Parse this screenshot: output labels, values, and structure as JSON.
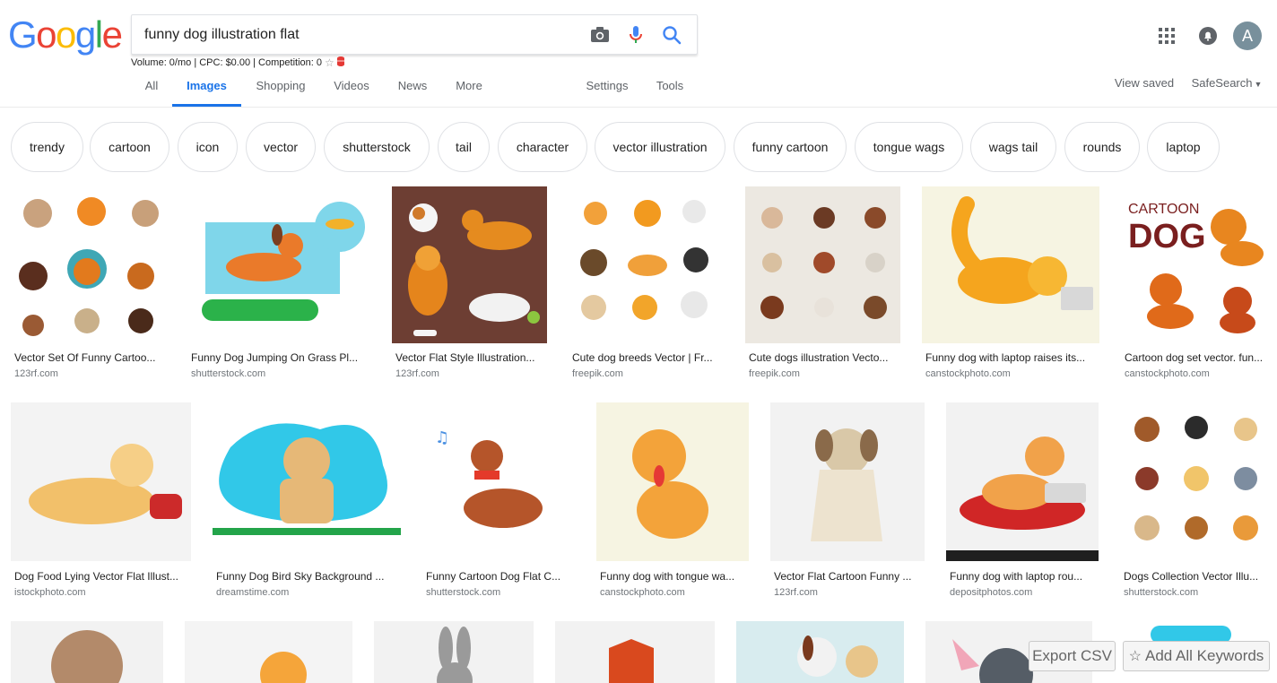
{
  "header": {
    "logo_letters": [
      "G",
      "o",
      "o",
      "g",
      "l",
      "e"
    ],
    "logo_colors": [
      "#4285F4",
      "#EA4335",
      "#FBBC05",
      "#4285F4",
      "#34A853",
      "#EA4335"
    ],
    "search_value": "funny dog illustration flat",
    "icons": {
      "camera": "camera-icon",
      "mic": "mic-icon",
      "search": "search-icon"
    },
    "meta_line": "Volume: 0/mo | CPC: $0.00 | Competition: 0",
    "avatar_letter": "A"
  },
  "tabs": {
    "all": "All",
    "images": "Images",
    "shopping": "Shopping",
    "videos": "Videos",
    "news": "News",
    "more": "More",
    "settings": "Settings",
    "tools": "Tools",
    "view_saved": "View saved",
    "safesearch": "SafeSearch"
  },
  "chips": [
    "trendy",
    "cartoon",
    "icon",
    "vector",
    "shutterstock",
    "tail",
    "character",
    "vector illustration",
    "funny cartoon",
    "tongue wags",
    "wags tail",
    "rounds",
    "laptop"
  ],
  "results": [
    {
      "title": "Vector Set Of Funny Cartoo...",
      "source": "123rf.com",
      "bg": "#ffffff"
    },
    {
      "title": "Funny Dog Jumping On Grass Pl...",
      "source": "shutterstock.com",
      "bg": "#ffffff"
    },
    {
      "title": "Vector Flat Style Illustration...",
      "source": "123rf.com",
      "bg": "#6d3e33"
    },
    {
      "title": "Cute dog breeds Vector | Fr...",
      "source": "freepik.com",
      "bg": "#ffffff"
    },
    {
      "title": "Cute dogs illustration Vecto...",
      "source": "freepik.com",
      "bg": "#ece8e1"
    },
    {
      "title": "Funny dog with laptop raises its...",
      "source": "canstockphoto.com",
      "bg": "#f6f4e2"
    },
    {
      "title": "Cartoon dog set vector. fun...",
      "source": "canstockphoto.com",
      "bg": "#ffffff"
    },
    {
      "title": "Dog Food Lying Vector Flat Illust...",
      "source": "istockphoto.com",
      "bg": "#f3f3f3"
    },
    {
      "title": "Funny Dog Bird Sky Background ...",
      "source": "dreamstime.com",
      "bg": "#ffffff"
    },
    {
      "title": "Funny Cartoon Dog Flat C...",
      "source": "shutterstock.com",
      "bg": "#ffffff"
    },
    {
      "title": "Funny dog with tongue wa...",
      "source": "canstockphoto.com",
      "bg": "#f6f4e2"
    },
    {
      "title": "Vector Flat Cartoon Funny ...",
      "source": "123rf.com",
      "bg": "#f2f2f2"
    },
    {
      "title": "Funny dog with laptop rou...",
      "source": "depositphotos.com",
      "bg": "#f2f2f2"
    },
    {
      "title": "Dogs Collection Vector Illu...",
      "source": "shutterstock.com",
      "bg": "#ffffff"
    }
  ],
  "bottom_row_bgs": [
    "#f2f2f2",
    "#f4f4f4",
    "#f2f2f2",
    "#f2f2f2",
    "#d8ecef",
    "#f2f2f2",
    "#ffffff"
  ],
  "floating": {
    "export_csv": "Export CSV",
    "add_all_keywords": "Add All Keywords"
  },
  "colors": {
    "accent_blue": "#1a73e8",
    "mic_red": "#ea4335",
    "chip_border": "#dfe1e5"
  }
}
